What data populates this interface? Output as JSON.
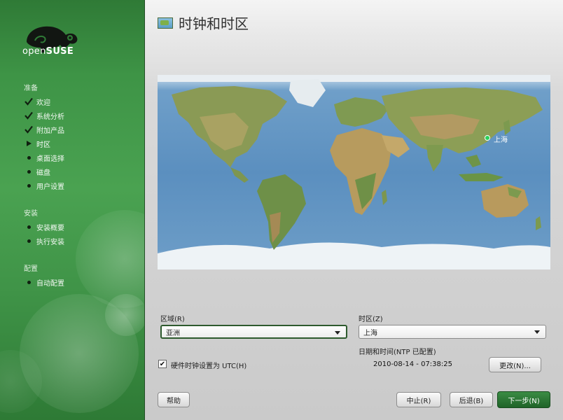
{
  "sidebar": {
    "logo_text_light": "open",
    "logo_text_bold": "SUSE",
    "sections": [
      {
        "title": "准备",
        "steps": [
          {
            "label": "欢迎",
            "state": "done"
          },
          {
            "label": "系统分析",
            "state": "done"
          },
          {
            "label": "附加产品",
            "state": "done"
          },
          {
            "label": "时区",
            "state": "current"
          },
          {
            "label": "桌面选择",
            "state": "pending"
          },
          {
            "label": "磁盘",
            "state": "pending"
          },
          {
            "label": "用户设置",
            "state": "pending"
          }
        ]
      },
      {
        "title": "安装",
        "steps": [
          {
            "label": "安装概要",
            "state": "pending"
          },
          {
            "label": "执行安装",
            "state": "pending"
          }
        ]
      },
      {
        "title": "配置",
        "steps": [
          {
            "label": "自动配置",
            "state": "pending"
          }
        ]
      }
    ]
  },
  "main": {
    "title": "时钟和时区",
    "map": {
      "selected_city": "上海"
    },
    "region": {
      "label": "区域(R)",
      "value": "亚洲"
    },
    "timezone": {
      "label": "时区(Z)",
      "value": "上海"
    },
    "datetime": {
      "label": "日期和时间(NTP 已配置)",
      "value": "2010-08-14 - 07:38:25"
    },
    "utc_checkbox": {
      "label": "硬件时钟设置为 UTC(H)",
      "checked": true
    },
    "change_button": "更改(N)...",
    "help_button": "帮助",
    "abort_button": "中止(R)",
    "back_button": "后退(B)",
    "next_button": "下一步(N)"
  },
  "colors": {
    "accent": "#2f7a36",
    "primary_button": "#1f6328"
  }
}
